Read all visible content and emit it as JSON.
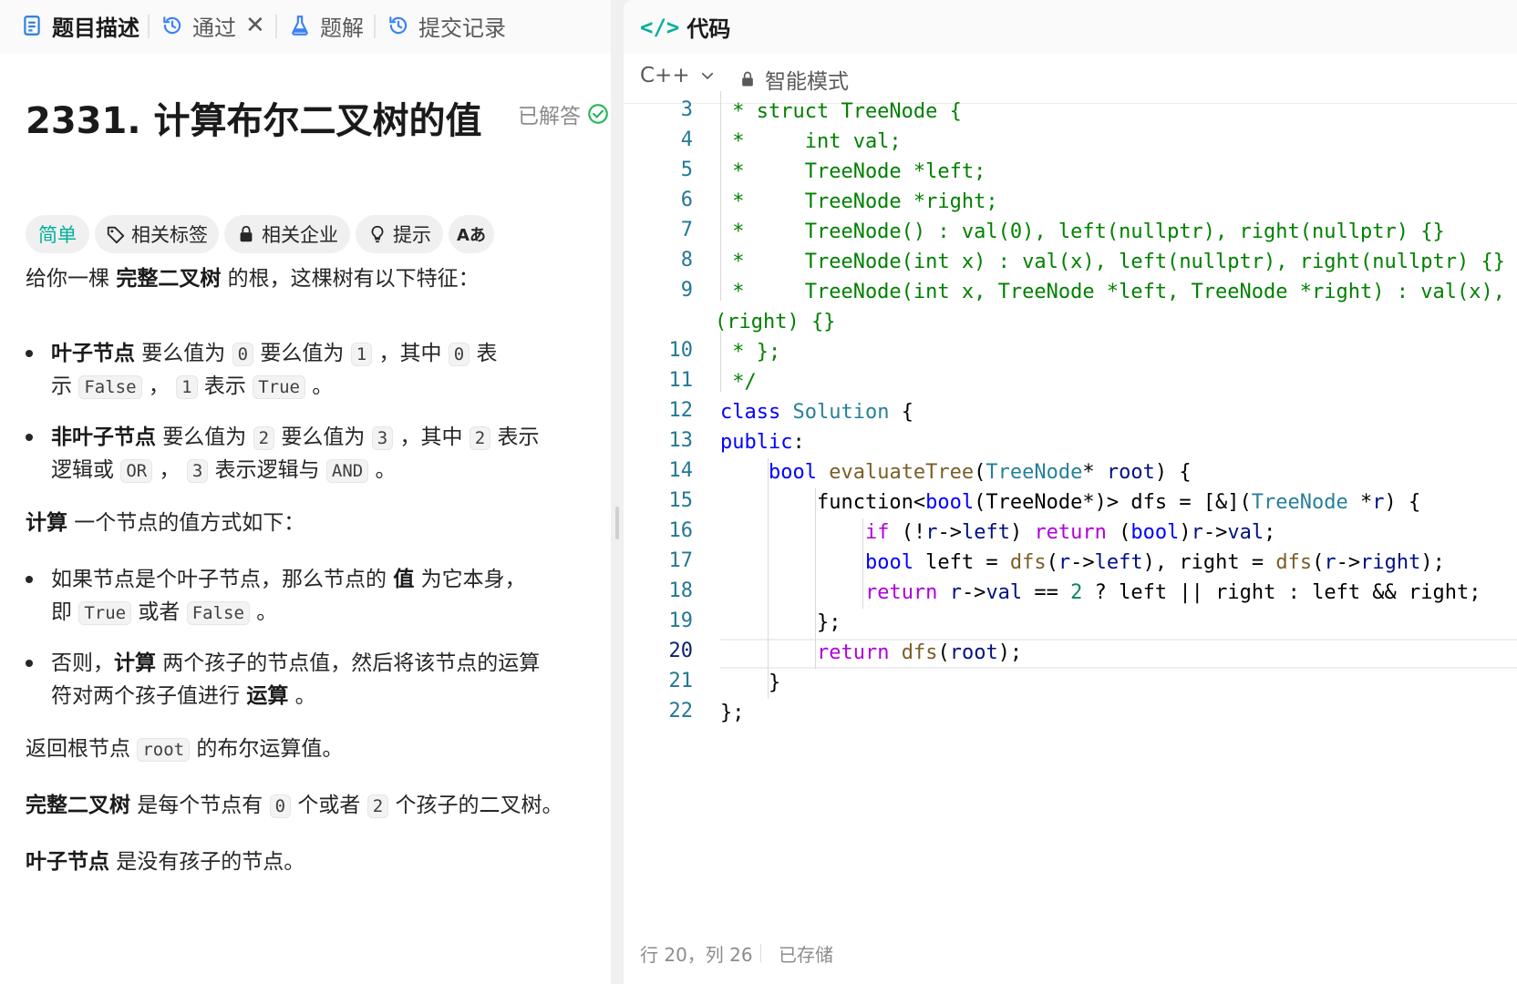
{
  "left_tabs": {
    "description": "题目描述",
    "passed": "通过",
    "passed_close": "✕",
    "solutions": "题解",
    "submissions": "提交记录"
  },
  "problem": {
    "title": "2331. 计算布尔二叉树的值",
    "status": "已解答",
    "tags": {
      "difficulty": "简单",
      "related_tags": "相关标签",
      "related_companies": "相关企业",
      "hint": "提示",
      "font_size_icon_label": "Aあ"
    },
    "intro": {
      "a": "给你一棵 ",
      "b": "完整二叉树",
      "c": " 的根，这棵树有以下特征："
    },
    "b1": {
      "bold": "叶子节点",
      "t1": " 要么值为 ",
      "c1": "0",
      "t2": " 要么值为 ",
      "c2": "1",
      "t3": " ，其中 ",
      "c3": "0",
      "t4": " 表",
      "t5": "示 ",
      "c4": "False",
      "t6": " ， ",
      "c5": "1",
      "t7": " 表示 ",
      "c6": "True",
      "t8": " 。"
    },
    "b2": {
      "bold": "非叶子节点",
      "t1": " 要么值为 ",
      "c1": "2",
      "t2": " 要么值为 ",
      "c2": "3",
      "t3": " ，其中 ",
      "c3": "2",
      "t4": " 表示",
      "t5": "逻辑或 ",
      "c4": "OR",
      "t6": " ， ",
      "c5": "3",
      "t7": " 表示逻辑与 ",
      "c6": "AND",
      "t8": " 。"
    },
    "calc": {
      "bold": "计算",
      "text": " 一个节点的值方式如下："
    },
    "b3": {
      "t1": "如果节点是个叶子节点，那么节点的 ",
      "bold": "值",
      "t2": " 为它本身，",
      "t3": "即 ",
      "c1": "True",
      "t4": " 或者 ",
      "c2": "False",
      "t5": " 。"
    },
    "b4": {
      "t1": "否则，",
      "bold1": "计算",
      "t2": " 两个孩子的节点值，然后将该节点的运算",
      "t3": "符对两个孩子值进行 ",
      "bold2": "运算",
      "t4": " 。"
    },
    "ret": {
      "t1": "返回根节点 ",
      "c1": "root",
      "t2": " 的布尔运算值。"
    },
    "full": {
      "bold": "完整二叉树",
      "t1": " 是每个节点有 ",
      "c1": "0",
      "t2": " 个或者 ",
      "c2": "2",
      "t3": " 个孩子的二叉树。"
    },
    "leaf": {
      "bold": "叶子节点",
      "text": " 是没有孩子的节点。"
    }
  },
  "code_panel": {
    "icon_glyph": "</>",
    "title": "代码",
    "language": "C++",
    "mode": "智能模式",
    "line_numbers": [
      "3",
      "4",
      "5",
      "6",
      "7",
      "8",
      "9",
      "10",
      "11",
      "12",
      "13",
      "14",
      "15",
      "16",
      "17",
      "18",
      "19",
      "20",
      "21",
      "22"
    ],
    "current_line": "20",
    "status_position": "行 20，列 26",
    "status_saved": "已存储"
  }
}
